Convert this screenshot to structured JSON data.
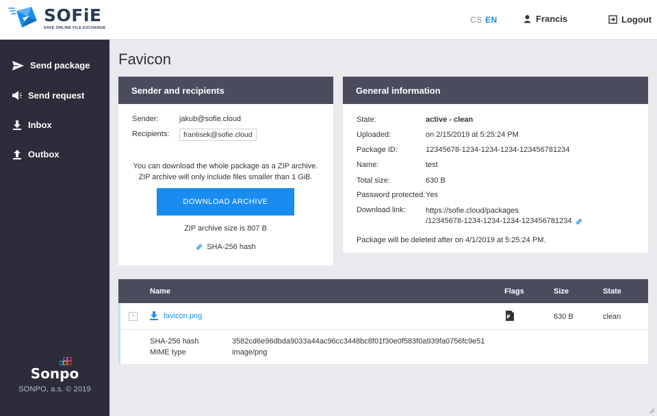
{
  "app": {
    "name": "SOFiE",
    "tagline": "SAFE ONLINE FILE EXCHANGE"
  },
  "header": {
    "lang_cs": "CS",
    "lang_en": "EN",
    "user_name": "Francis",
    "logout_label": "Logout"
  },
  "sidebar": {
    "items": [
      {
        "label": "Send package",
        "icon": "paper-plane-icon"
      },
      {
        "label": "Send request",
        "icon": "megaphone-icon"
      },
      {
        "label": "Inbox",
        "icon": "download-icon"
      },
      {
        "label": "Outbox",
        "icon": "upload-icon"
      }
    ],
    "footer_brand": "Sonpo",
    "footer_copyright": "SONPO, a.s. © 2019"
  },
  "page": {
    "title": "Favicon"
  },
  "sender_card": {
    "heading": "Sender and recipients",
    "sender_label": "Sender:",
    "sender_value": "jakub@sofie.cloud",
    "recipients_label": "Recipients:",
    "recipients": [
      "frantisek@sofie.cloud"
    ],
    "download_note_line1": "You can download the whole package as a ZIP archive.",
    "download_note_line2": "ZIP archive will only include files smaller than 1 GiB.",
    "download_button": "DOWNLOAD ARCHIVE",
    "archive_size": "ZIP archive size is 807 B",
    "hash_link": "SHA-256 hash"
  },
  "general_card": {
    "heading": "General information",
    "rows": [
      {
        "label": "State:",
        "value": "active - clean"
      },
      {
        "label": "Uploaded:",
        "value": "on 2/15/2019 at 5:25:24 PM"
      },
      {
        "label": "Package ID:",
        "value": "12345678-1234-1234-1234-123456781234"
      },
      {
        "label": "Name:",
        "value": "test"
      },
      {
        "label": "Total size:",
        "value": "630 B"
      },
      {
        "label": "Password protected:",
        "value": "Yes"
      },
      {
        "label": "Download link:",
        "value_line1": "https://sofie.cloud/packages",
        "value_line2": "/12345678-1234-1234-1234-123456781234"
      }
    ],
    "deletion_note": "Package will be deleted after on 4/1/2019 at 5:25:24 PM."
  },
  "files_table": {
    "columns": [
      "Name",
      "Flags",
      "Size",
      "State"
    ],
    "rows": [
      {
        "toggle": "-",
        "name": "favicon.png",
        "size": "630 B",
        "state": "clean",
        "details": [
          {
            "label": "SHA-256 hash",
            "value": "3582cd6e96dbda9033a44ac96cc3448bc8f01f30e0f583f0a939fa0756fc9e51"
          },
          {
            "label": "MIME type",
            "value": "image/png"
          }
        ]
      }
    ]
  },
  "colors": {
    "accent": "#1a8cf0",
    "sidebar_bg": "#2c2c3a",
    "card_header_bg": "#4a4c5e",
    "page_bg": "#e9e9ee"
  }
}
